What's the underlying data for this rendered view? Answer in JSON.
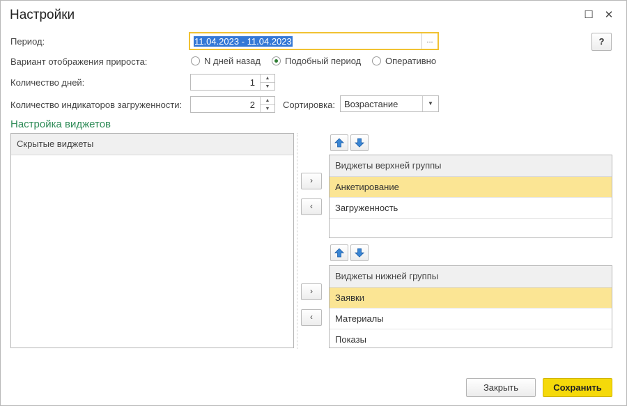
{
  "window": {
    "title": "Настройки"
  },
  "form": {
    "period_label": "Период:",
    "period_value": "11.04.2023 - 11.04.2023",
    "period_select_glyph": "...",
    "help_label": "?",
    "variant_label": "Вариант отображения прироста:",
    "variant_options": [
      {
        "label": "N дней назад",
        "selected": false
      },
      {
        "label": "Подобный период",
        "selected": true
      },
      {
        "label": "Оперативно",
        "selected": false
      }
    ],
    "days_label": "Количество дней:",
    "days_value": "1",
    "indicators_label": "Количество индикаторов загруженности:",
    "indicators_value": "2",
    "sort_label": "Сортировка:",
    "sort_value": "Возрастание"
  },
  "widgets": {
    "section_title": "Настройка виджетов",
    "hidden": {
      "header": "Скрытые виджеты",
      "items": []
    },
    "top": {
      "header": "Виджеты верхней группы",
      "items": [
        "Анкетирование",
        "Загруженность"
      ],
      "selected_index": 0
    },
    "bottom": {
      "header": "Виджеты нижней группы",
      "items": [
        "Заявки",
        "Материалы",
        "Показы"
      ],
      "selected_index": 0
    }
  },
  "icons": {
    "move_right": "›",
    "move_left": "‹",
    "restore": "☐",
    "close": "✕"
  },
  "footer": {
    "close_label": "Закрыть",
    "save_label": "Сохранить"
  },
  "colors": {
    "accent_green": "#2e8b57",
    "selection": "#fbe594",
    "save_button": "#f5d90a",
    "focus": "#f1c232"
  }
}
